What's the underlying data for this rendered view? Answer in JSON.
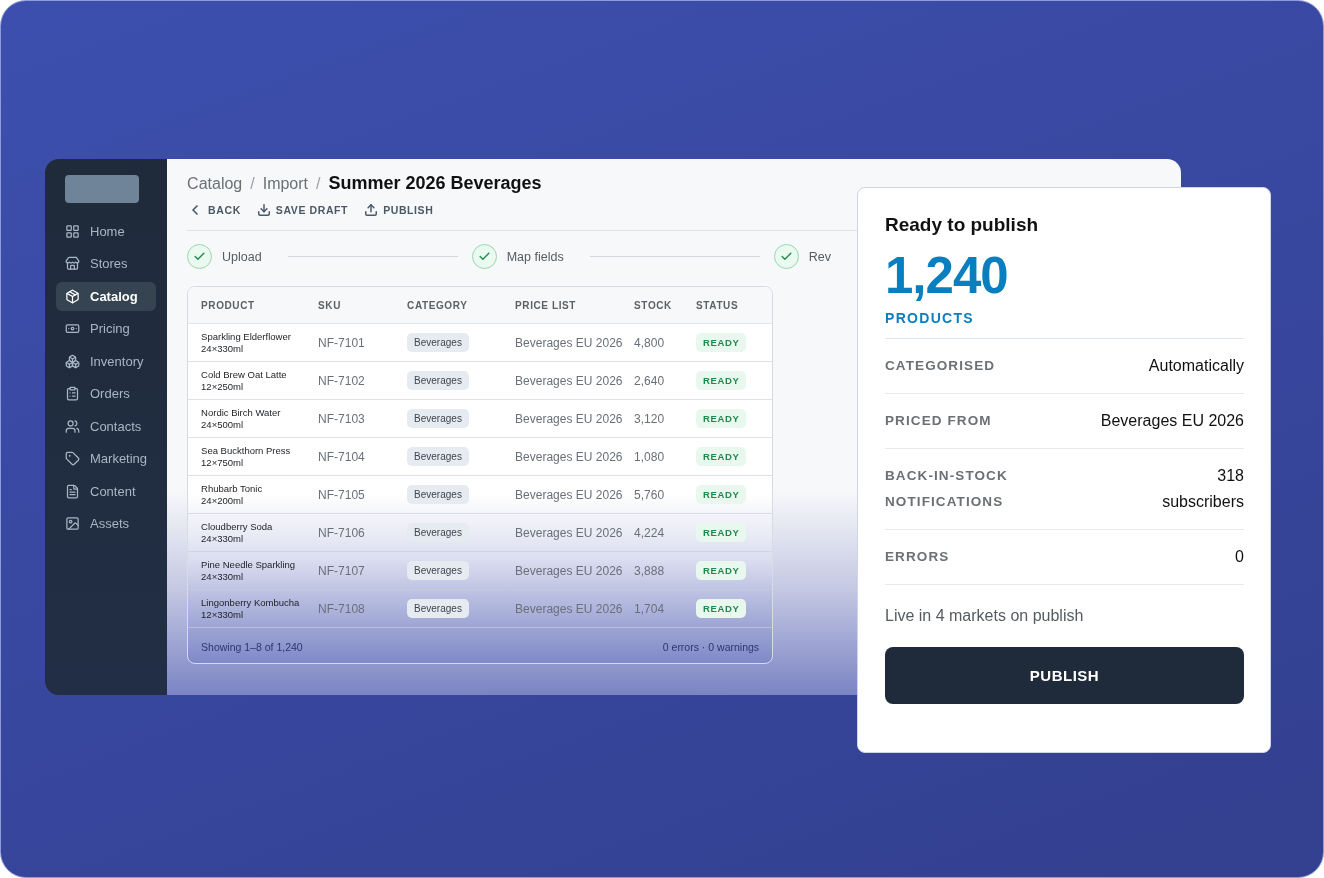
{
  "sidebar": {
    "items": [
      {
        "label": "Home",
        "selected": false
      },
      {
        "label": "Stores",
        "selected": false
      },
      {
        "label": "Catalog",
        "selected": true
      },
      {
        "label": "Pricing",
        "selected": false
      },
      {
        "label": "Inventory",
        "selected": false
      },
      {
        "label": "Orders",
        "selected": false
      },
      {
        "label": "Contacts",
        "selected": false
      },
      {
        "label": "Marketing",
        "selected": false
      },
      {
        "label": "Content",
        "selected": false
      },
      {
        "label": "Assets",
        "selected": false
      }
    ]
  },
  "breadcrumb": [
    "Catalog",
    "Import"
  ],
  "breadcrumb_separator": "/",
  "page_title": "Summer 2026 Beverages",
  "toolbar": [
    {
      "kind": "back",
      "label": "BACK"
    },
    {
      "kind": "save",
      "label": "SAVE DRAFT"
    },
    {
      "kind": "publish",
      "label": "PUBLISH"
    }
  ],
  "steps": [
    {
      "label": "Upload",
      "done": true
    },
    {
      "label": "Map fields",
      "done": true
    },
    {
      "label": "Rev",
      "done": true
    }
  ],
  "table": {
    "columns": [
      "PRODUCT",
      "SKU",
      "CATEGORY",
      "PRICE LIST",
      "STOCK",
      "STATUS"
    ],
    "rows": [
      {
        "product": "Sparkling Elderflower",
        "pack": "24×330ml",
        "sku": "NF-7101",
        "category": "Beverages",
        "price_list": "Beverages EU 2026",
        "stock": "4,800",
        "status": "READY"
      },
      {
        "product": "Cold Brew Oat Latte",
        "pack": "12×250ml",
        "sku": "NF-7102",
        "category": "Beverages",
        "price_list": "Beverages EU 2026",
        "stock": "2,640",
        "status": "READY"
      },
      {
        "product": "Nordic Birch Water",
        "pack": "24×500ml",
        "sku": "NF-7103",
        "category": "Beverages",
        "price_list": "Beverages EU 2026",
        "stock": "3,120",
        "status": "READY"
      },
      {
        "product": "Sea Buckthorn Press",
        "pack": "12×750ml",
        "sku": "NF-7104",
        "category": "Beverages",
        "price_list": "Beverages EU 2026",
        "stock": "1,080",
        "status": "READY"
      },
      {
        "product": "Rhubarb Tonic",
        "pack": "24×200ml",
        "sku": "NF-7105",
        "category": "Beverages",
        "price_list": "Beverages EU 2026",
        "stock": "5,760",
        "status": "READY"
      },
      {
        "product": "Cloudberry Soda",
        "pack": "24×330ml",
        "sku": "NF-7106",
        "category": "Beverages",
        "price_list": "Beverages EU 2026",
        "stock": "4,224",
        "status": "READY"
      },
      {
        "product": "Pine Needle Sparkling",
        "pack": "24×330ml",
        "sku": "NF-7107",
        "category": "Beverages",
        "price_list": "Beverages EU 2026",
        "stock": "3,888",
        "status": "READY"
      },
      {
        "product": "Lingonberry Kombucha",
        "pack": "12×330ml",
        "sku": "NF-7108",
        "category": "Beverages",
        "price_list": "Beverages EU 2026",
        "stock": "1,704",
        "status": "READY"
      }
    ],
    "footer_left": "Showing 1–8 of 1,240",
    "footer_right": "0 errors · 0 warnings"
  },
  "publish_card": {
    "title": "Ready to publish",
    "count": "1,240",
    "count_label": "PRODUCTS",
    "details": [
      {
        "label": "CATEGORISED",
        "value": "Automatically"
      },
      {
        "label": "PRICED FROM",
        "value": "Beverages EU 2026"
      },
      {
        "label": "BACK-IN-STOCK NOTIFICATIONS",
        "value": "318\nsubscribers"
      },
      {
        "label": "ERRORS",
        "value": "0"
      }
    ],
    "note": "Live in 4 markets on publish",
    "button": "PUBLISH"
  }
}
